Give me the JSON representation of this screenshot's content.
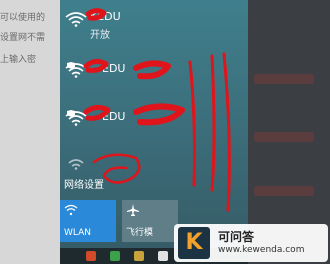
{
  "background_article": {
    "lines": [
      "可以使用的",
      "设置网不需",
      "上输入密"
    ]
  },
  "networks": [
    {
      "ssid": "KEDU",
      "status": "开放",
      "secured": false
    },
    {
      "ssid": "EDU",
      "status": "",
      "secured": true
    },
    {
      "ssid": "EDU",
      "status": "",
      "secured": true
    },
    {
      "ssid": "",
      "status": "",
      "secured": false
    }
  ],
  "network_settings_label": "网络设置",
  "tiles": {
    "wlan": {
      "label": "WLAN",
      "icon": "wifi-icon",
      "active": true,
      "color": "#2a89d8"
    },
    "airplane": {
      "label": "飞行模",
      "icon": "airplane-icon",
      "active": false
    }
  },
  "watermark": {
    "logo_letter": "K",
    "name": "可问答",
    "url": "www.kewenda.com"
  },
  "colors": {
    "annotation": "#e0141b",
    "panel": "#3f7f8c"
  }
}
